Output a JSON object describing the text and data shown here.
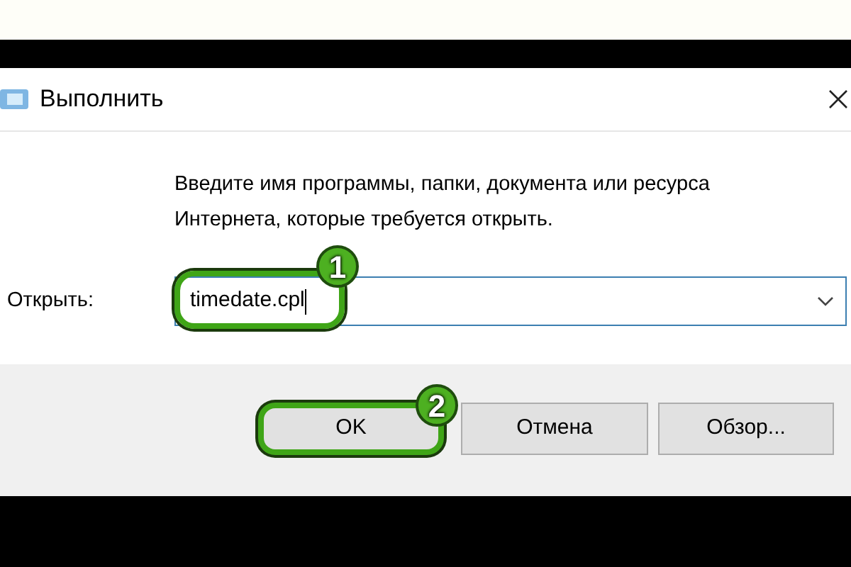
{
  "window": {
    "title": "Выполнить"
  },
  "description": "Введите имя программы, папки, документа или ресурса Интернета, которые требуется открыть.",
  "open_field": {
    "label": "Открыть:",
    "value": "timedate.cpl"
  },
  "buttons": [
    {
      "label": "OK",
      "highlighted": true,
      "badge": "2"
    },
    {
      "label": "Отмена",
      "highlighted": false
    },
    {
      "label": "Обзор...",
      "highlighted": false
    }
  ],
  "field_badge": "1"
}
